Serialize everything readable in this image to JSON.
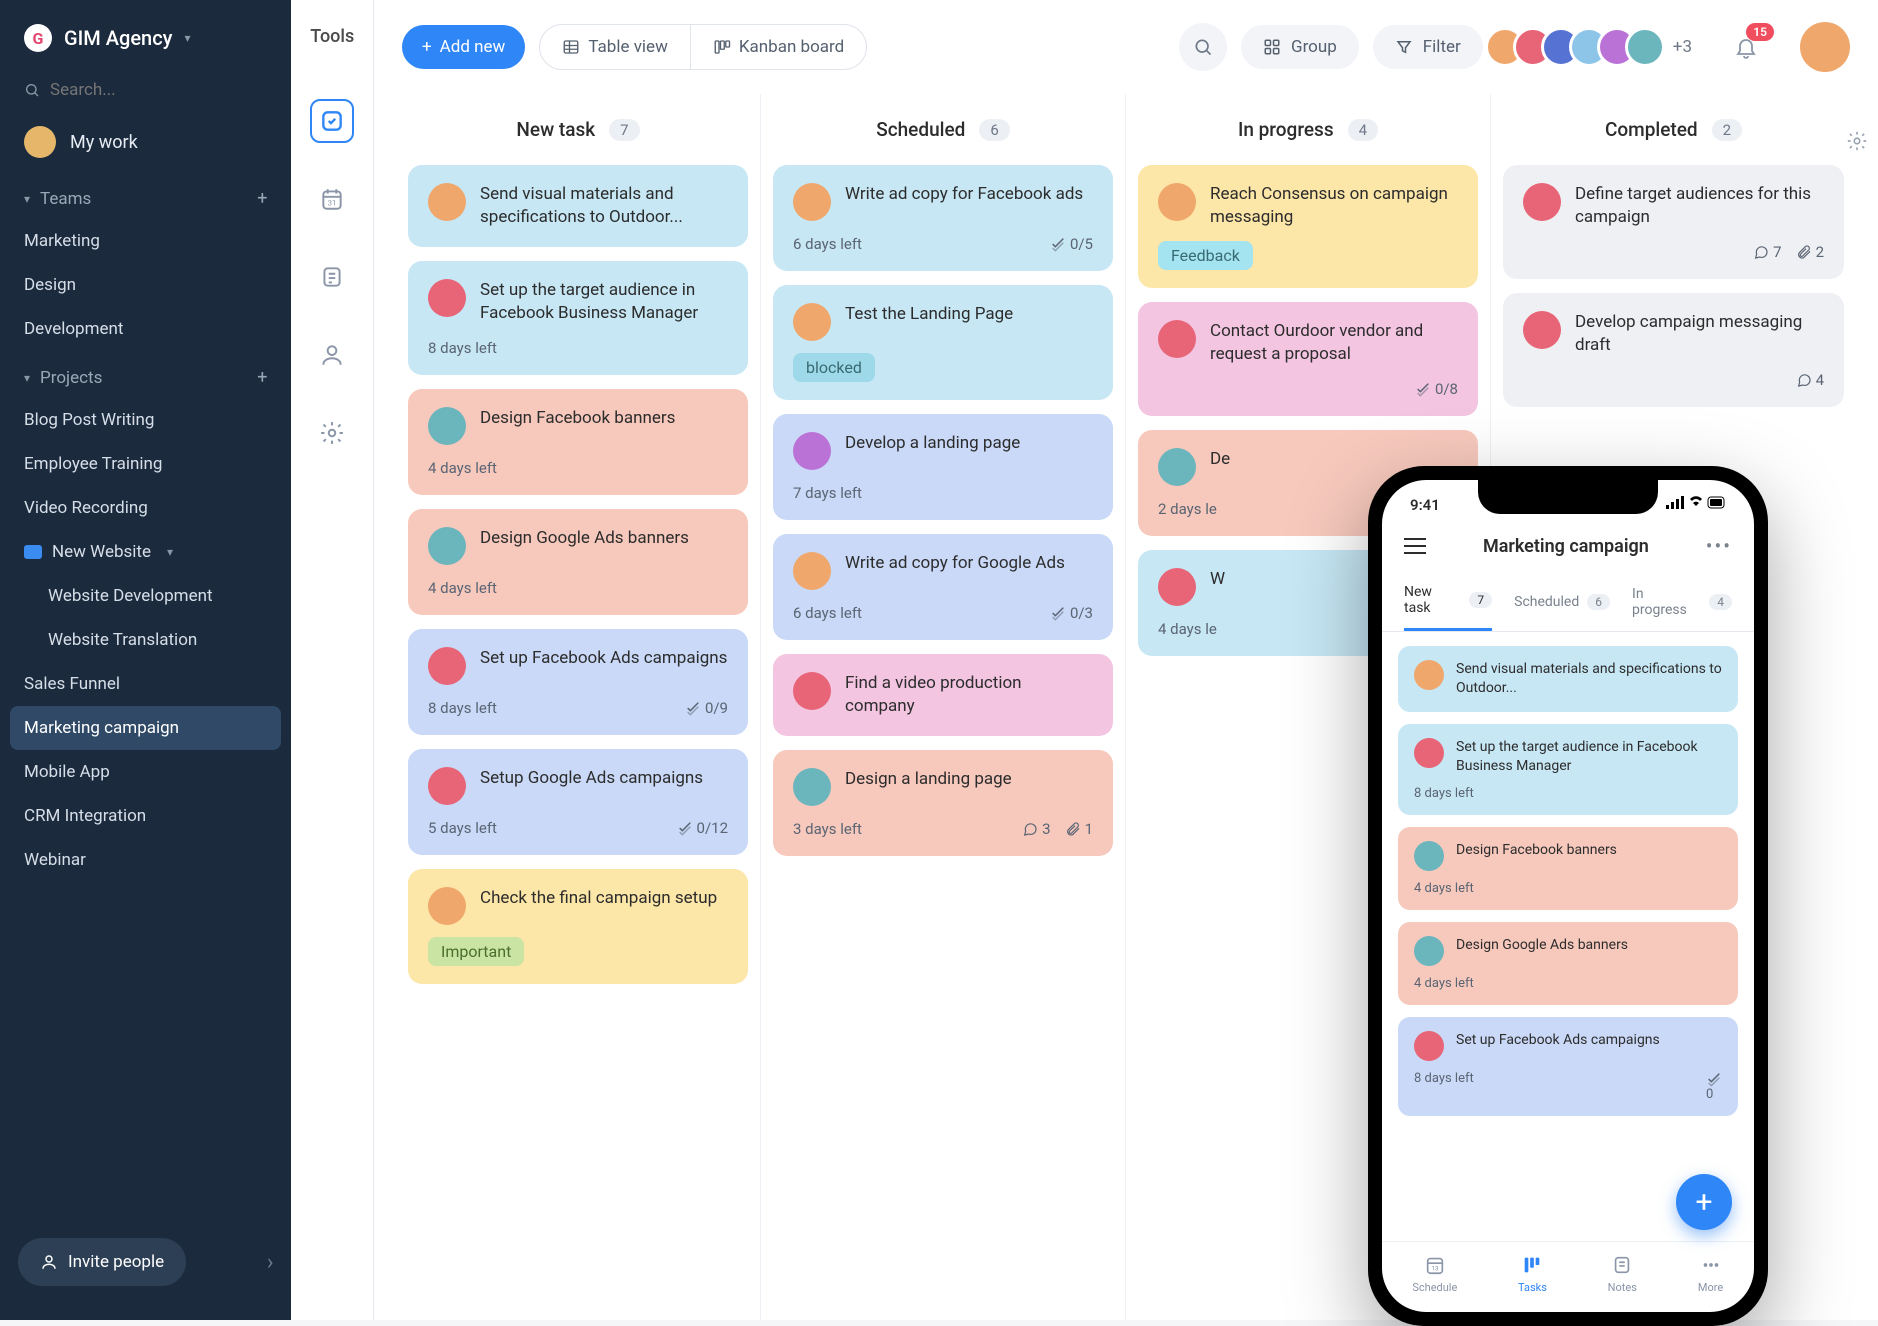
{
  "workspace": {
    "name": "GIM Agency",
    "logo_letter": "G"
  },
  "search": {
    "placeholder": "Search..."
  },
  "mywork": {
    "label": "My work"
  },
  "sidebar": {
    "teams_label": "Teams",
    "teams": [
      "Marketing",
      "Design",
      "Development"
    ],
    "projects_label": "Projects",
    "projects": [
      {
        "label": "Blog Post Writing"
      },
      {
        "label": "Employee Training"
      },
      {
        "label": "Video Recording"
      },
      {
        "label": "New Website",
        "folder": true,
        "children": [
          "Website Development",
          "Website Translation"
        ]
      },
      {
        "label": "Sales Funnel"
      },
      {
        "label": "Marketing campaign",
        "active": true
      },
      {
        "label": "Mobile App"
      },
      {
        "label": "CRM Integration"
      },
      {
        "label": "Webinar"
      }
    ],
    "invite": "Invite people"
  },
  "toolrail": {
    "label": "Tools"
  },
  "topbar": {
    "add_new": "Add new",
    "table_view": "Table view",
    "kanban_view": "Kanban board",
    "group": "Group",
    "filter": "Filter",
    "more_avatars": "+3",
    "notifications": "15"
  },
  "columns": [
    {
      "title": "New task",
      "count": "7",
      "cards": [
        {
          "color": "c-blue",
          "avatar": "c1",
          "title": "Send visual materials and specifications to Outdoor..."
        },
        {
          "color": "c-blue",
          "avatar": "c2",
          "title": "Set up the target audience in Facebook Business Manager",
          "due": "8 days left"
        },
        {
          "color": "c-salmon",
          "avatar": "c6",
          "title": "Design Facebook banners",
          "due": "4 days left"
        },
        {
          "color": "c-salmon",
          "avatar": "c6",
          "title": "Design Google Ads banners",
          "due": "4 days left"
        },
        {
          "color": "c-lblue",
          "avatar": "c2",
          "title": "Set up Facebook Ads campaigns",
          "due": "8 days left",
          "check": "0/9"
        },
        {
          "color": "c-lblue",
          "avatar": "c2",
          "title": "Setup Google Ads campaigns",
          "due": "5 days left",
          "check": "0/12"
        },
        {
          "color": "c-yellow",
          "avatar": "c1",
          "title": "Check the final campaign setup",
          "tag": "Important",
          "tagclass": "important"
        }
      ]
    },
    {
      "title": "Scheduled",
      "count": "6",
      "cards": [
        {
          "color": "c-blue",
          "avatar": "c1",
          "title": "Write ad copy for Facebook ads",
          "due": "6 days left",
          "check": "0/5"
        },
        {
          "color": "c-blue",
          "avatar": "c1",
          "title": "Test the Landing Page",
          "tag": "blocked",
          "tagclass": "blocked"
        },
        {
          "color": "c-lblue",
          "avatar": "c5",
          "title": "Develop a landing page",
          "due": "7 days left"
        },
        {
          "color": "c-lblue",
          "avatar": "c1",
          "title": "Write ad copy for Google Ads",
          "due": "6 days left",
          "check": "0/3"
        },
        {
          "color": "c-pink",
          "avatar": "c2",
          "title": "Find a video production company"
        },
        {
          "color": "c-salmon",
          "avatar": "c6",
          "title": "Design a landing page",
          "due": "3 days left",
          "comments": "3",
          "attach": "1"
        }
      ]
    },
    {
      "title": "In progress",
      "count": "4",
      "cards": [
        {
          "color": "c-yellow",
          "avatar": "c1",
          "title": "Reach Consensus on campaign messaging",
          "tag": "Feedback",
          "tagclass": "feedback"
        },
        {
          "color": "c-pink",
          "avatar": "c2",
          "title": "Contact Ourdoor vendor and request a proposal",
          "check": "0/8"
        },
        {
          "color": "c-salmon",
          "avatar": "c6",
          "title": "De",
          "due": "2 days le"
        },
        {
          "color": "c-blue",
          "avatar": "c2",
          "title": "W",
          "due": "4 days le"
        }
      ]
    },
    {
      "title": "Completed",
      "count": "2",
      "cards": [
        {
          "color": "c-gray",
          "avatar": "c2",
          "title": "Define target audiences for this campaign",
          "comments": "7",
          "attach": "2"
        },
        {
          "color": "c-gray",
          "avatar": "c2",
          "title": "Develop campaign messaging draft",
          "comments": "4"
        }
      ]
    }
  ],
  "phone": {
    "time": "9:41",
    "title": "Marketing campaign",
    "tabs": [
      {
        "label": "New task",
        "count": "7",
        "active": true
      },
      {
        "label": "Scheduled",
        "count": "6"
      },
      {
        "label": "In progress",
        "count": "4"
      }
    ],
    "cards": [
      {
        "color": "c-blue",
        "avatar": "c1",
        "title": "Send visual materials and specifications to Outdoor..."
      },
      {
        "color": "c-blue",
        "avatar": "c2",
        "title": "Set up the target audience in Facebook Business Manager",
        "due": "8 days left"
      },
      {
        "color": "c-salmon",
        "avatar": "c6",
        "title": "Design Facebook banners",
        "due": "4 days left"
      },
      {
        "color": "c-salmon",
        "avatar": "c6",
        "title": "Design Google Ads banners",
        "due": "4 days left"
      },
      {
        "color": "c-lblue",
        "avatar": "c2",
        "title": "Set up Facebook Ads campaigns",
        "due": "8 days left",
        "check": "0"
      }
    ],
    "bottom": [
      {
        "label": "Schedule"
      },
      {
        "label": "Tasks",
        "active": true
      },
      {
        "label": "Notes"
      },
      {
        "label": "More"
      }
    ]
  }
}
